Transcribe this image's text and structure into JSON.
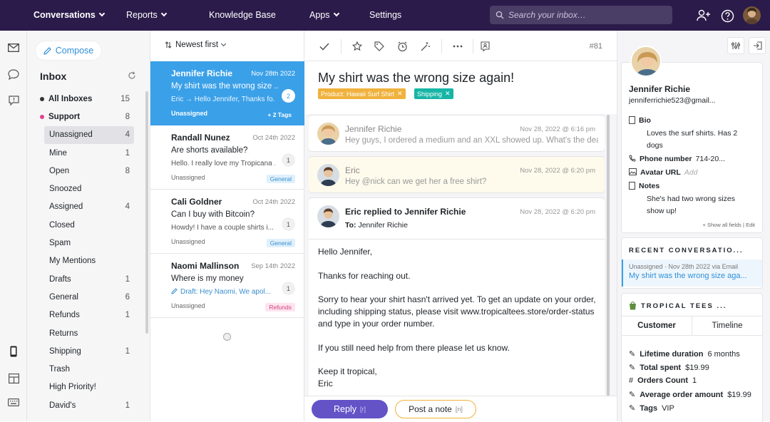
{
  "topnav": {
    "conversations": "Conversations",
    "reports": "Reports",
    "knowledge_base": "Knowledge Base",
    "apps": "Apps",
    "settings": "Settings",
    "search_placeholder": "Search your inbox…"
  },
  "sidebar": {
    "compose": "Compose",
    "inbox_title": "Inbox",
    "folders": [
      {
        "label": "All Inboxes",
        "count": "15"
      },
      {
        "label": "Support",
        "count": "8"
      },
      {
        "label": "Unassigned",
        "count": "4"
      },
      {
        "label": "Mine",
        "count": "1"
      },
      {
        "label": "Open",
        "count": "8"
      },
      {
        "label": "Snoozed",
        "count": ""
      },
      {
        "label": "Assigned",
        "count": "4"
      },
      {
        "label": "Closed",
        "count": ""
      },
      {
        "label": "Spam",
        "count": ""
      },
      {
        "label": "My Mentions",
        "count": ""
      },
      {
        "label": "Drafts",
        "count": "1"
      },
      {
        "label": "General",
        "count": "6"
      },
      {
        "label": "Refunds",
        "count": "1"
      },
      {
        "label": "Returns",
        "count": ""
      },
      {
        "label": "Shipping",
        "count": "1"
      },
      {
        "label": "Trash",
        "count": ""
      },
      {
        "label": "High Priority!",
        "count": ""
      },
      {
        "label": "David's",
        "count": "1"
      }
    ]
  },
  "list": {
    "sort": "Newest first",
    "items": [
      {
        "name": "Jennifer Richie",
        "date": "Nov 28th 2022",
        "subject": "My shirt was the wrong size ...",
        "preview": "Eric → Hello Jennifer,   Thanks fo...",
        "status": "Unassigned",
        "count": "2",
        "tag": "+ 2 Tags"
      },
      {
        "name": "Randall Nunez",
        "date": "Oct 24th 2022",
        "subject": "Are shorts available?",
        "preview": "Hello. I really love my Tropicana ...",
        "status": "Unassigned",
        "count": "1",
        "tag": "General"
      },
      {
        "name": "Cali Goldner",
        "date": "Oct 24th 2022",
        "subject": "Can I buy with Bitcoin?",
        "preview": "Howdy! I have a couple shirts i...",
        "status": "Unassigned",
        "count": "1",
        "tag": "General"
      },
      {
        "name": "Naomi Mallinson",
        "date": "Sep 14th 2022",
        "subject": "Where is my money",
        "preview": "Draft: Hey Naomi, We apol...",
        "status": "Unassigned",
        "count": "1",
        "tag": "Refunds"
      }
    ]
  },
  "conversation": {
    "number": "#81",
    "title": "My shirt was the wrong size again!",
    "tags": [
      "Product: Hawaii Surf Shirt",
      "Shipping"
    ],
    "messages": [
      {
        "from": "Jennifer Richie",
        "when": "Nov 28, 2022 @ 6:16 pm",
        "snippet": "Hey guys, I ordered a medium and an XXL showed up.  What's the deal?"
      },
      {
        "from": "Eric",
        "when": "Nov 28, 2022 @ 6:20 pm",
        "snippet": "Hey @nick can we get her a free shirt?"
      },
      {
        "from": "Eric replied to Jennifer Richie",
        "when": "Nov 28, 2022 @ 6:20 pm",
        "to_label": "To:",
        "to": "Jennifer Richie",
        "body": [
          "Hello Jennifer,",
          "Thanks for reaching out.",
          "Sorry to hear your shirt hasn't arrived yet.  To get an update on your order, including shipping status, please visit www.tropicaltees.store/order-status and type in your order number.",
          "If you still need help from there please let us know.",
          "Keep it tropical,",
          "Eric"
        ]
      }
    ],
    "reply": "Reply",
    "reply_key": "[r]",
    "note": "Post a note",
    "note_key": "[n]"
  },
  "customer": {
    "name": "Jennifer Richie",
    "email": "jenniferrichie523@gmail...",
    "bio_label": "Bio",
    "bio": "Loves the surf shirts. Has 2 dogs",
    "phone_label": "Phone number",
    "phone": "714-20...",
    "avatar_label": "Avatar URL",
    "avatar_value": "Add",
    "notes_label": "Notes",
    "notes": "She's had two wrong sizes show up!",
    "show_all": "+ Show all fields",
    "edit": "Edit",
    "recent_title": "RECENT CONVERSATIO...",
    "recent_meta": "Unassigned · Nov 28th 2022 via Email",
    "recent_subject": "My shirt was the wrong size aga...",
    "shop_title": "TROPICAL TEES ...",
    "tab_customer": "Customer",
    "tab_timeline": "Timeline",
    "stats": [
      {
        "label": "Lifetime duration",
        "value": "6 months"
      },
      {
        "label": "Total spent",
        "value": "$19.99"
      },
      {
        "label": "Orders Count",
        "value": "1"
      },
      {
        "label": "Average order amount",
        "value": "$19.99"
      },
      {
        "label": "Tags",
        "value": "VIP"
      }
    ]
  },
  "colors": {
    "topbar": "#2b1b4a",
    "accent": "#3aa0e8",
    "reply": "#6353c7",
    "note": "#f0b23c"
  }
}
